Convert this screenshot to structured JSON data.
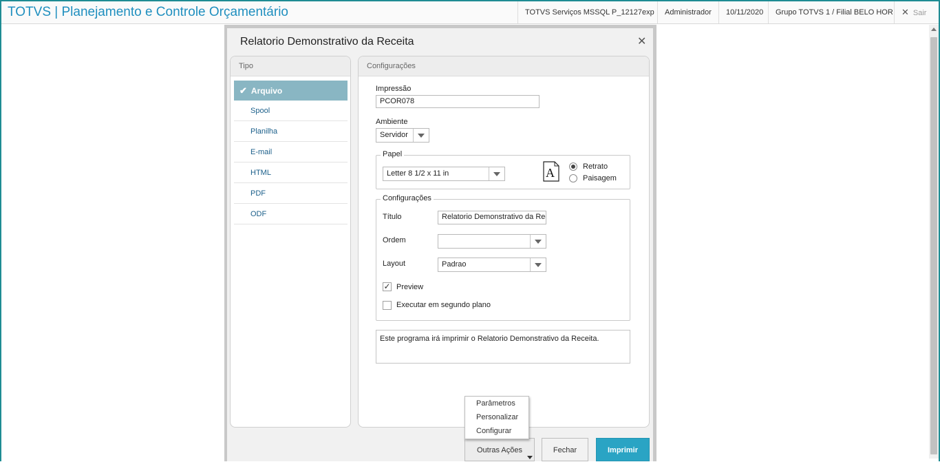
{
  "header": {
    "app_title": "TOTVS | Planejamento e Controle Orçamentário",
    "server": "TOTVS Serviços MSSQL P_12127exp",
    "user": "Administrador",
    "date": "10/11/2020",
    "branch": "Grupo TOTVS 1 / Filial BELO HOR",
    "exit_label": "Sair"
  },
  "dialog": {
    "title": "Relatorio Demonstrativo da Receita",
    "tipo": {
      "header": "Tipo",
      "items": [
        {
          "label": "Arquivo",
          "selected": true
        },
        {
          "label": "Spool"
        },
        {
          "label": "Planilha"
        },
        {
          "label": "E-mail"
        },
        {
          "label": "HTML"
        },
        {
          "label": "PDF"
        },
        {
          "label": "ODF"
        }
      ]
    },
    "config": {
      "header": "Configurações",
      "impressao_label": "Impressão",
      "impressao_value": "PCOR078",
      "ambiente_label": "Ambiente",
      "ambiente_value": "Servidor",
      "papel": {
        "legend": "Papel",
        "size_value": "Letter 8 1/2 x 11 in",
        "orientation_options": [
          "Retrato",
          "Paisagem"
        ],
        "orientation_selected": "Retrato"
      },
      "settings": {
        "legend": "Configurações",
        "titulo_label": "Título",
        "titulo_value": "Relatorio Demonstrativo da Rec",
        "ordem_label": "Ordem",
        "ordem_value": "",
        "layout_label": "Layout",
        "layout_value": "Padrao",
        "preview_label": "Preview",
        "preview_checked": true,
        "background_label": "Executar em segundo plano",
        "background_checked": false
      },
      "description": "Este programa irá imprimir o Relatorio Demonstrativo da Receita."
    },
    "menu": {
      "items": [
        "Parâmetros",
        "Personalizar",
        "Configurar"
      ]
    },
    "footer": {
      "more_actions": "Outras Ações",
      "close": "Fechar",
      "print": "Imprimir"
    }
  },
  "colors": {
    "accent": "#1e8c93",
    "title_blue": "#1f8fbf",
    "selected_item": "#89b6c3",
    "print_button": "#2aa4c4"
  }
}
